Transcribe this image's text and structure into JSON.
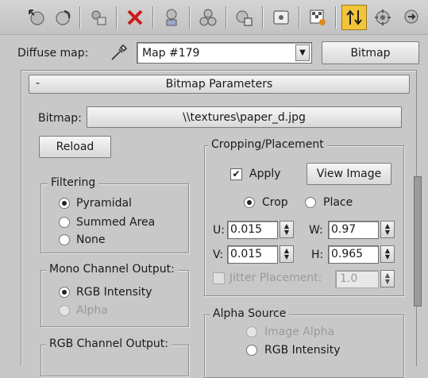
{
  "toolbar": {
    "icons": [
      "go-to-parent-icon",
      "go-forward-icon",
      "pick-material-icon",
      "delete-icon",
      "show-map-icon",
      "show-end-result-icon",
      "material-id-icon",
      "video-color-check-icon",
      "make-preview-icon",
      "go-to-sibling-icon",
      "options-icon",
      "navigate-icon"
    ]
  },
  "map_row": {
    "label": "Diffuse map:",
    "map_name": "Map #179",
    "map_type": "Bitmap"
  },
  "rollout": {
    "collapse_symbol": "-",
    "title": "Bitmap Parameters"
  },
  "bitmap": {
    "label": "Bitmap:",
    "path": "\\\\textures\\paper_d.jpg",
    "reload": "Reload"
  },
  "filtering": {
    "title": "Filtering",
    "options": [
      "Pyramidal",
      "Summed Area",
      "None"
    ],
    "selected": "Pyramidal"
  },
  "mono": {
    "title": "Mono Channel Output:",
    "options": [
      "RGB Intensity",
      "Alpha"
    ],
    "selected": "RGB Intensity"
  },
  "rgb_channel": {
    "title": "RGB Channel Output:"
  },
  "cropping": {
    "title": "Cropping/Placement",
    "apply_label": "Apply",
    "apply_checked": true,
    "view_image": "View Image",
    "crop": "Crop",
    "place": "Place",
    "mode": "Crop",
    "u_label": "U:",
    "u_value": "0.015",
    "v_label": "V:",
    "v_value": "0.015",
    "w_label": "W:",
    "w_value": "0.97",
    "h_label": "H:",
    "h_value": "0.965",
    "jitter_label": "Jitter Placement:",
    "jitter_value": "1.0"
  },
  "alpha_source": {
    "title": "Alpha Source",
    "options": [
      "Image Alpha",
      "RGB Intensity"
    ],
    "selected": "RGB Intensity"
  }
}
